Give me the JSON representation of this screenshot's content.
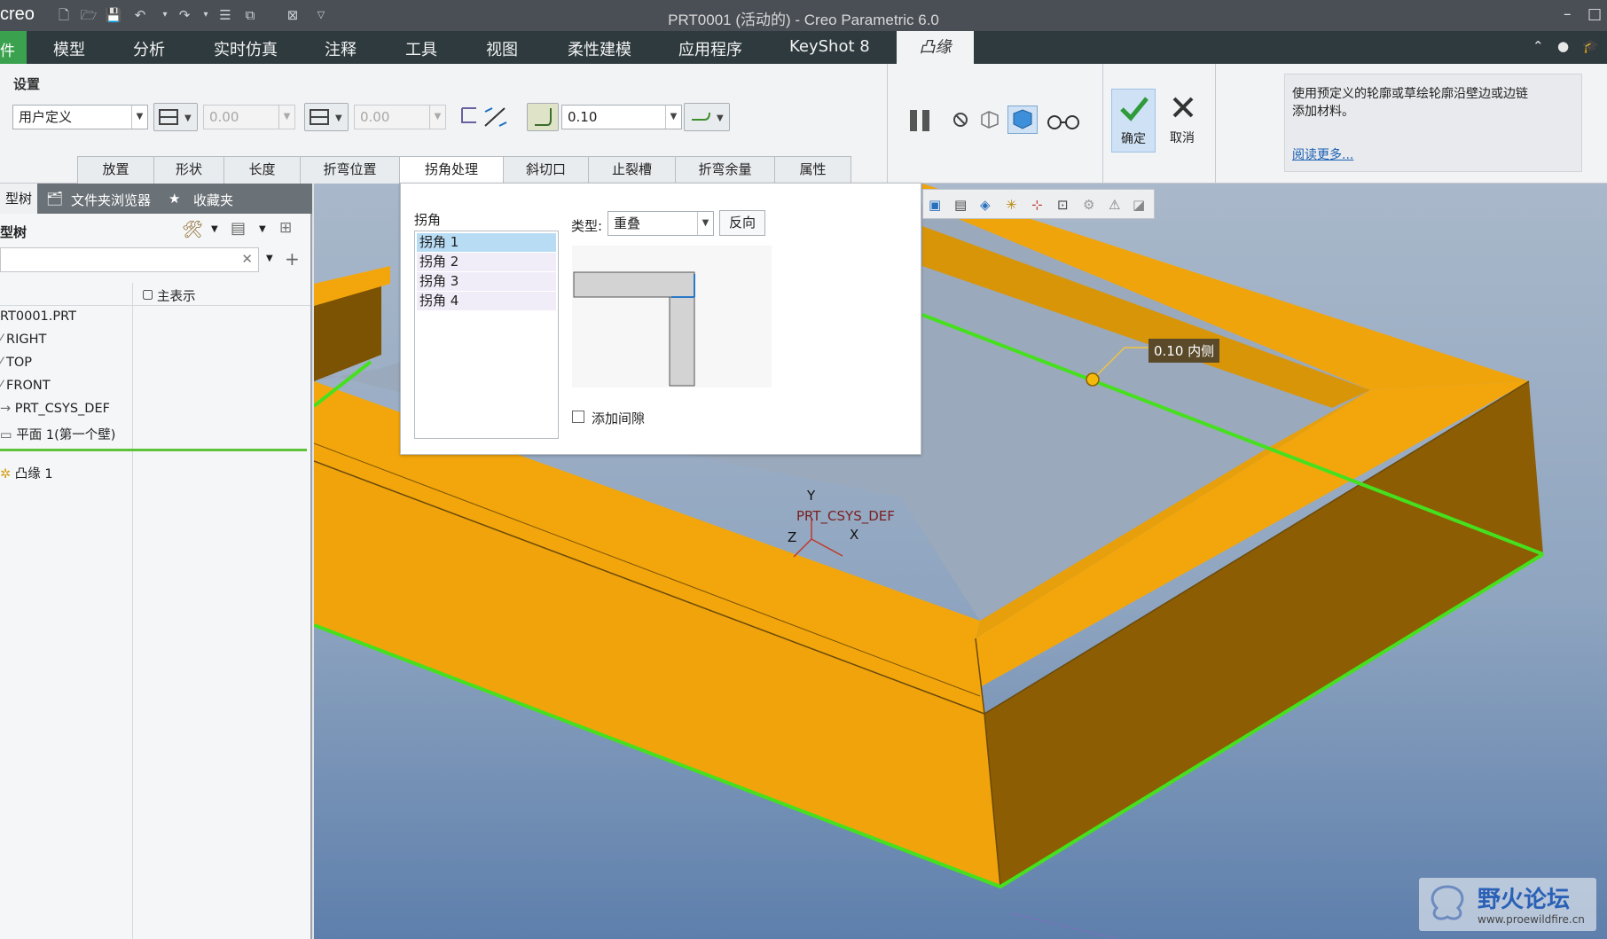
{
  "titlebar": {
    "logo": "creo",
    "window_title": "PRT0001 (活动的) - Creo Parametric 6.0",
    "minimize_glyph": "–",
    "maximize_glyph": "□"
  },
  "menubar": {
    "first_partial": "件",
    "items": [
      "模型",
      "分析",
      "实时仿真",
      "注释",
      "工具",
      "视图",
      "柔性建模",
      "应用程序",
      "KeyShot 8"
    ],
    "active_tab": "凸缘"
  },
  "ribbon": {
    "settings_label": "设置",
    "shape_type_value": "用户定义",
    "length1_value": "0.00",
    "length2_value": "0.00",
    "radius_value": "0.10",
    "subtabs": [
      "放置",
      "形状",
      "长度",
      "折弯位置",
      "拐角处理",
      "斜切口",
      "止裂槽",
      "折弯余量",
      "属性"
    ],
    "active_subtab": "拐角处理",
    "confirm_label": "确定",
    "cancel_label": "取消",
    "hint_text_line1": "使用预定义的轮廓或草绘轮廓沿壁边或边链",
    "hint_text_line2": "添加材料。",
    "read_more": "阅读更多..."
  },
  "left_panel": {
    "tabs": [
      "型树",
      "文件夹浏览器",
      "收藏夹"
    ],
    "tree_title": "型树",
    "search_placeholder": "",
    "column_header": "主表示",
    "tree_items": [
      "RT0001.PRT",
      "RIGHT",
      "TOP",
      "FRONT",
      "PRT_CSYS_DEF",
      "平面 1(第一个壁)",
      "凸缘 1"
    ]
  },
  "corner_popup": {
    "list_label": "拐角",
    "corners": [
      "拐角 1",
      "拐角 2",
      "拐角 3",
      "拐角 4"
    ],
    "selected_corner": "拐角 1",
    "type_label": "类型:",
    "type_value": "重叠",
    "flip_button": "反向",
    "add_gap_label": "添加间隙",
    "add_gap_checked": false
  },
  "viewport": {
    "dimension_label": "0.10 内侧",
    "csys_label": "PRT_CSYS_DEF",
    "axis_x": "X",
    "axis_y": "Y",
    "axis_z": "Z"
  },
  "watermark": {
    "text": "野火论坛",
    "url": "www.proewildfire.cn"
  },
  "colors": {
    "part_top": "#f5a70c",
    "part_side": "#8a5c04",
    "edge_highlight": "#46e01e",
    "menubar": "#2e3a3e",
    "titlebar": "#4a4f55"
  }
}
